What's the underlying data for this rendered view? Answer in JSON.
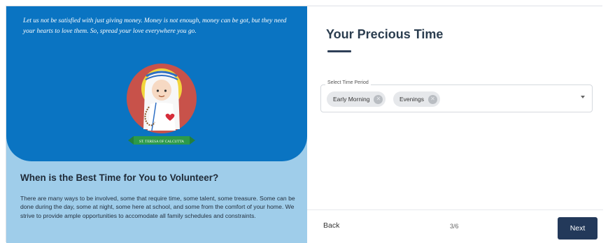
{
  "left_panel": {
    "quote": "Let us not be satisfied with just giving money. Money is not enough, money can be got, but they need your hearts to love them. So, spread your love everywhere you go.",
    "saint_banner": "ST. TERESA OF CALCUTTA",
    "section_title": "When is the Best Time for You to Volunteer?",
    "section_body": "There are many ways to be involved, some that require time, some talent, some treasure. Some can be done during the day, some at night, some here at school, and some from the comfort of your home. We strive to provide ample opportunities to accomodate all family schedules and constraints.",
    "colors": {
      "hero": "#0a74c2",
      "panel": "#9fcdea"
    }
  },
  "right_panel": {
    "title": "Your Precious Time",
    "select": {
      "label": "Select Time Period",
      "chips": [
        "Early Morning",
        "Evenings"
      ]
    },
    "footer": {
      "back_label": "Back",
      "progress": "3/6",
      "next_label": "Next"
    },
    "colors": {
      "accent": "#23395a"
    }
  },
  "icons": [
    "chip-remove-icon",
    "dropdown-caret-icon"
  ]
}
